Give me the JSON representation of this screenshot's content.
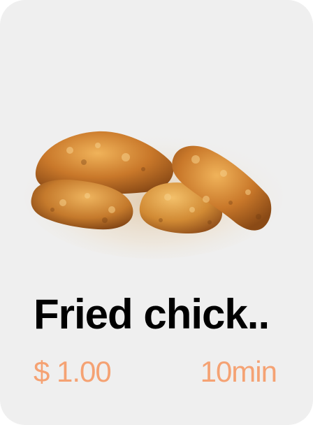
{
  "card": {
    "image": {
      "icon": "fried-chicken-photo"
    },
    "title": "Fried chick..",
    "price": "$ 1.00",
    "time": "10min"
  },
  "colors": {
    "card_background": "#efefef",
    "title": "#000000",
    "accent": "#f5a273"
  }
}
